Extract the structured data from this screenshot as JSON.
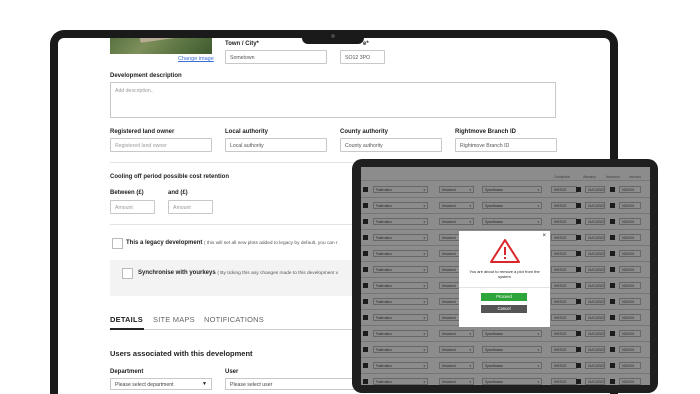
{
  "form": {
    "change_image": "Change image",
    "town_label": "Town / City*",
    "town_value": "Sometown",
    "postcode_label_partial": "e*",
    "postcode_value": "SO12 3PO",
    "description_label": "Development description",
    "description_placeholder": "Add description..",
    "land_owner_label": "Registered land owner",
    "land_owner_placeholder": "Registered land owner",
    "local_authority_label": "Local authority",
    "local_authority_value": "Local authority",
    "county_authority_label": "County authority",
    "county_authority_value": "County authority",
    "rightmove_label": "Rightmove Branch ID",
    "rightmove_value": "Rightmove Branch ID",
    "cooling_label": "Cooling off period possible cost retention",
    "between_label": "Between (£)",
    "and_label": "and (£)",
    "amount_placeholder_1": "Amount",
    "amount_placeholder_2": "Amount",
    "legacy_title": "This a legacy development",
    "legacy_desc": "( this will set all new plots added to legacy by default, you can r",
    "sync_title": "Synchronise with yourkeys",
    "sync_desc": "( By ticking this any changes made to this development v"
  },
  "tabs": [
    {
      "label": "DETAILS",
      "active": true
    },
    {
      "label": "SITE MAPS",
      "active": false
    },
    {
      "label": "NOTIFICATIONS",
      "active": false
    }
  ],
  "users": {
    "title": "Users associated with this development",
    "department_label": "Department",
    "department_value": "Please select department",
    "user_label": "User",
    "user_value": "Please select user"
  },
  "tablet": {
    "headers": [
      "Completion",
      "Warranty",
      "Handover",
      "Invoiced"
    ],
    "row_values": {
      "col1": "Fabrication",
      "col2": "Detached",
      "col3": "Specification",
      "col4": "9/9/2022",
      "col5": "01/01/2022",
      "col6": "0000001"
    },
    "modal": {
      "close": "×",
      "message": "You are about to remove a plot from the system",
      "proceed": "Proceed",
      "cancel": "Cancel"
    }
  },
  "colors": {
    "proceed": "#2da53a",
    "cancel": "#555555",
    "warning": "#d9262b",
    "link": "#3a6fd8"
  }
}
